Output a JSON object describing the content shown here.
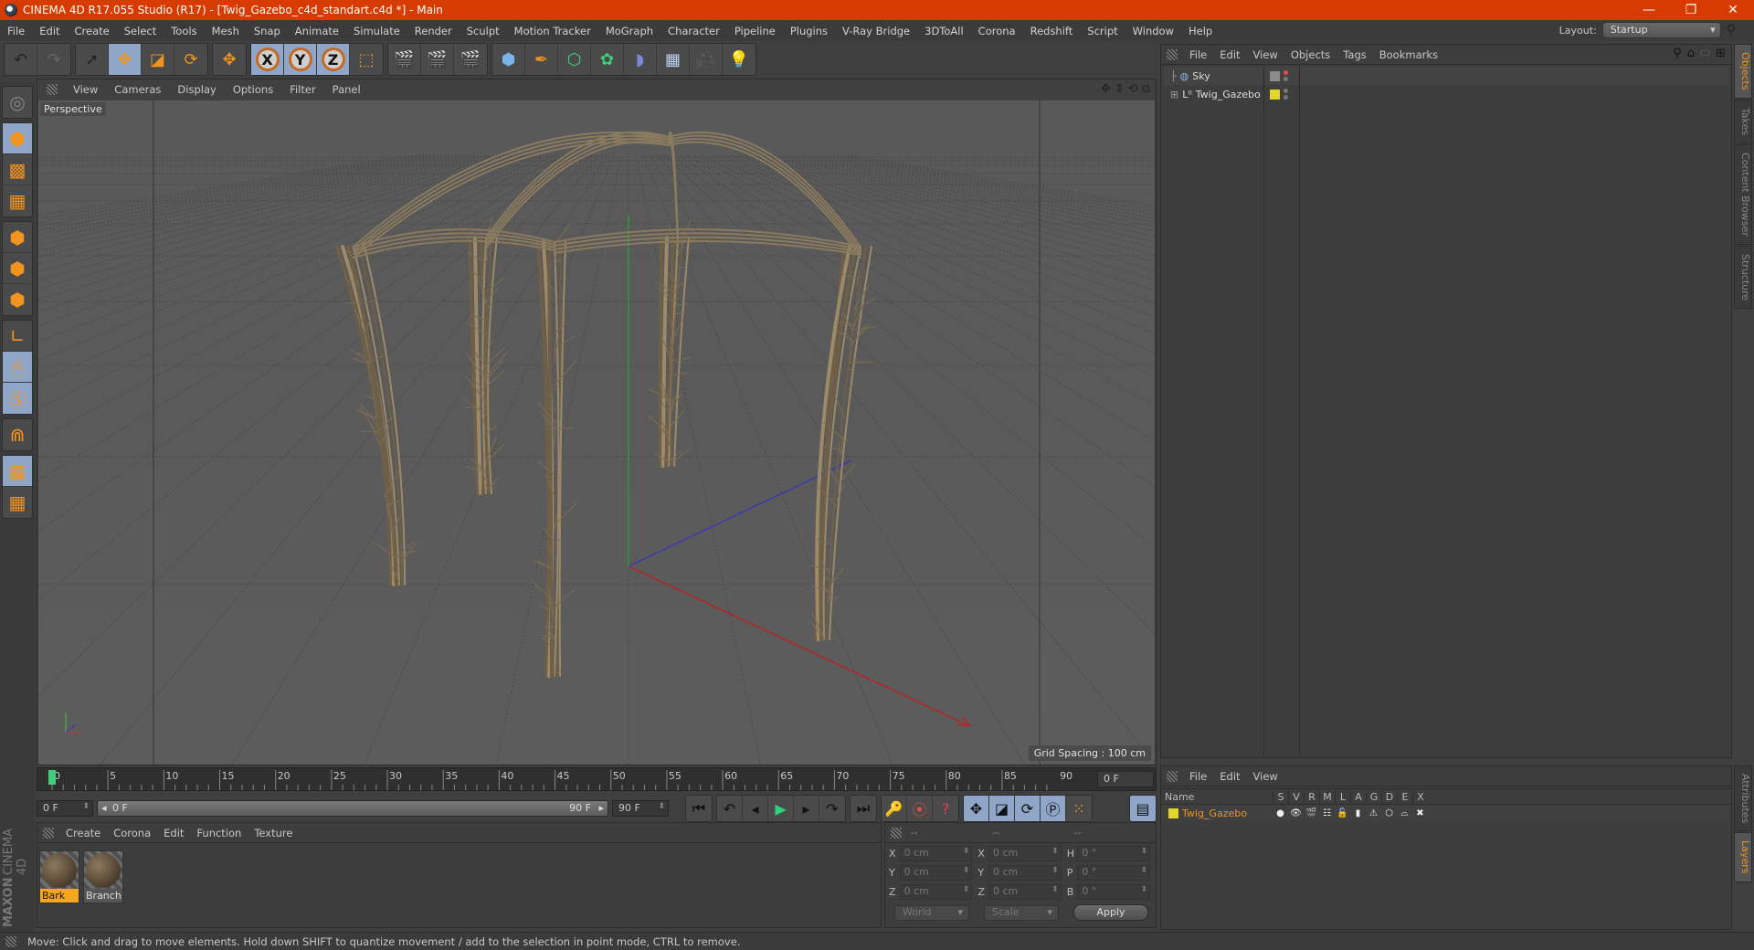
{
  "window": {
    "title": "CINEMA 4D R17.055 Studio (R17) - [Twig_Gazebo_c4d_standart.c4d *] - Main",
    "controls": {
      "minimize": "—",
      "restore": "❐",
      "close": "✕"
    }
  },
  "menubar": {
    "items": [
      "File",
      "Edit",
      "Create",
      "Select",
      "Tools",
      "Mesh",
      "Snap",
      "Animate",
      "Simulate",
      "Render",
      "Sculpt",
      "Motion Tracker",
      "MoGraph",
      "Character",
      "Pipeline",
      "Plugins",
      "V-Ray Bridge",
      "3DToAll",
      "Corona",
      "Redshift",
      "Script",
      "Window",
      "Help"
    ],
    "layout_label": "Layout:",
    "layout_value": "Startup"
  },
  "toolbar": {
    "groups": [
      [
        {
          "icon": "undo-icon",
          "glyph": "↶"
        },
        {
          "icon": "redo-icon",
          "glyph": "↷"
        }
      ],
      [
        {
          "icon": "live-selection-icon",
          "glyph": "➚"
        },
        {
          "icon": "move-icon",
          "glyph": "✥",
          "active": true
        },
        {
          "icon": "scale-icon",
          "glyph": "◪"
        },
        {
          "icon": "rotate-icon",
          "glyph": "⟳"
        }
      ],
      [
        {
          "icon": "recent-tool-icon",
          "glyph": "✥"
        }
      ],
      [
        {
          "icon": "x-axis-icon",
          "glyph": "X",
          "active": true
        },
        {
          "icon": "y-axis-icon",
          "glyph": "Y",
          "active": true
        },
        {
          "icon": "z-axis-icon",
          "glyph": "Z",
          "active": true
        },
        {
          "icon": "coordinate-system-icon",
          "glyph": "⬚"
        }
      ],
      [
        {
          "icon": "render-view-icon",
          "glyph": "🎬"
        },
        {
          "icon": "render-picture-viewer-icon",
          "glyph": "🎬"
        },
        {
          "icon": "render-settings-icon",
          "glyph": "🎬"
        }
      ],
      [
        {
          "icon": "cube-icon",
          "glyph": "⬢"
        },
        {
          "icon": "pen-spline-icon",
          "glyph": "✒"
        },
        {
          "icon": "subdivision-surface-icon",
          "glyph": "⬡"
        },
        {
          "icon": "cloner-icon",
          "glyph": "✿"
        },
        {
          "icon": "deformer-icon",
          "glyph": "◗"
        },
        {
          "icon": "floor-icon",
          "glyph": "▦"
        },
        {
          "icon": "camera-icon",
          "glyph": "🎥"
        },
        {
          "icon": "light-icon",
          "glyph": "💡"
        }
      ]
    ]
  },
  "left_tools": {
    "groups": [
      [
        {
          "icon": "make-editable-icon",
          "glyph": "◎"
        }
      ],
      [
        {
          "icon": "model-mode-icon",
          "glyph": "⬢",
          "active": true
        },
        {
          "icon": "texture-mode-icon",
          "glyph": "▩"
        },
        {
          "icon": "workplane-mode-icon",
          "glyph": "▦"
        }
      ],
      [
        {
          "icon": "points-mode-icon",
          "glyph": "⬢"
        },
        {
          "icon": "edges-mode-icon",
          "glyph": "⬢"
        },
        {
          "icon": "polygons-mode-icon",
          "glyph": "⬢"
        }
      ],
      [
        {
          "icon": "axis-mode-icon",
          "glyph": "∟"
        },
        {
          "icon": "tweak-mode-icon",
          "glyph": "🖱",
          "active": true
        },
        {
          "icon": "solo-mode-icon",
          "glyph": "Ⓢ",
          "active": true
        }
      ],
      [
        {
          "icon": "snap-magnet-icon",
          "glyph": "⋒"
        }
      ],
      [
        {
          "icon": "workplane-lock-icon",
          "glyph": "▦",
          "active": true
        },
        {
          "icon": "workplane-align-icon",
          "glyph": "▦"
        }
      ]
    ]
  },
  "viewport": {
    "menu": [
      "View",
      "Cameras",
      "Display",
      "Options",
      "Filter",
      "Panel"
    ],
    "label": "Perspective",
    "grid_spacing": "Grid Spacing : 100 cm",
    "nav_icons": [
      "move-view-icon",
      "zoom-view-icon",
      "rotate-view-icon",
      "toggle-view-icon"
    ]
  },
  "timeline": {
    "ticks": [
      "0",
      "5",
      "10",
      "15",
      "20",
      "25",
      "30",
      "35",
      "40",
      "45",
      "50",
      "55",
      "60",
      "65",
      "70",
      "75",
      "80",
      "85",
      "90"
    ],
    "current_frame": "0 F",
    "playhead_frame": 0
  },
  "transport": {
    "start_field": "0 F",
    "range_start": "0 F",
    "range_end": "90 F",
    "end_field": "90 F",
    "buttons": [
      "go-to-start-icon",
      "prev-key-icon",
      "prev-frame-icon",
      "play-icon",
      "next-frame-icon",
      "next-key-icon",
      "go-to-end-icon"
    ],
    "key_buttons": [
      "motion-record-icon",
      "record-active-icon",
      "autokey-icon"
    ],
    "key_mode_buttons": [
      "key-position-icon",
      "key-scale-icon",
      "key-rotation-icon",
      "key-parameter-icon",
      "key-pla-icon"
    ],
    "timeline_button": "timeline-window-icon"
  },
  "materials": {
    "menu": [
      "Create",
      "Corona",
      "Edit",
      "Function",
      "Texture"
    ],
    "items": [
      {
        "name": "Bark",
        "selected": true
      },
      {
        "name": "Branch",
        "selected": false
      }
    ]
  },
  "branding": {
    "maxon": "MAXON",
    "product": "CINEMA 4D"
  },
  "coordinates": {
    "headers": [
      "--",
      "--",
      "--"
    ],
    "rows": [
      {
        "a": "X",
        "av": "0 cm",
        "b": "X",
        "bv": "0 cm",
        "c": "H",
        "cv": "0 °"
      },
      {
        "a": "Y",
        "av": "0 cm",
        "b": "Y",
        "bv": "0 cm",
        "c": "P",
        "cv": "0 °"
      },
      {
        "a": "Z",
        "av": "0 cm",
        "b": "Z",
        "bv": "0 cm",
        "c": "B",
        "cv": "0 °"
      }
    ],
    "space": "World",
    "mode": "Scale",
    "apply": "Apply"
  },
  "object_manager": {
    "menu": [
      "File",
      "Edit",
      "View",
      "Objects",
      "Tags",
      "Bookmarks"
    ],
    "objects": [
      {
        "name": "Sky",
        "icon": "sky-icon",
        "tag_color": "#8a8a8a",
        "dot_top": "#e05050"
      },
      {
        "name": "Twig_Gazebo",
        "icon": "null-object-icon",
        "tag_color": "#e3d62a",
        "dot_top": "#777777",
        "expandable": true
      }
    ]
  },
  "right_tabs_top": [
    {
      "label": "Objects",
      "active": true
    },
    {
      "label": "Takes",
      "active": false
    },
    {
      "label": "Content Browser",
      "active": false
    },
    {
      "label": "Structure",
      "active": false
    }
  ],
  "layer_manager": {
    "menu": [
      "File",
      "Edit",
      "View"
    ],
    "columns": [
      "Name",
      "S",
      "V",
      "R",
      "M",
      "L",
      "A",
      "G",
      "D",
      "E",
      "X"
    ],
    "layers": [
      {
        "name": "Twig_Gazebo",
        "color": "#e3d62a",
        "icons": [
          "●",
          "👁",
          "🎬",
          "☷",
          "🔓",
          "▮",
          "⚠",
          "⬡",
          "⌓",
          "✖"
        ]
      }
    ]
  },
  "right_tabs_bottom": [
    {
      "label": "Attributes",
      "active": false
    },
    {
      "label": "Layers",
      "active": true
    }
  ],
  "status": "Move: Click and drag to move elements. Hold down SHIFT to quantize movement / add to the selection in point mode, CTRL to remove.",
  "colors": {
    "titlebar": "#d83b01",
    "accent": "#f0931f",
    "active_button": "#8fa6c8",
    "panel": "#3d3d3d",
    "viewport": "#5a5a5a"
  }
}
